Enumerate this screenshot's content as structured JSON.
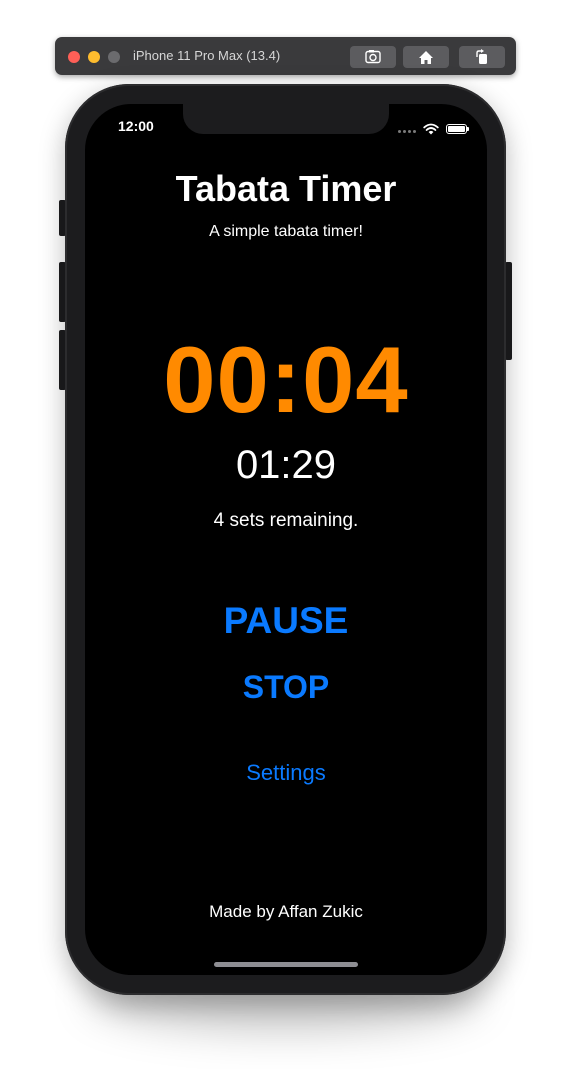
{
  "simulator": {
    "title": "iPhone 11 Pro Max (13.4)",
    "toolbar_icons": [
      "screenshot-icon",
      "home-icon",
      "rotate-icon"
    ]
  },
  "status_bar": {
    "time": "12:00"
  },
  "app": {
    "title": "Tabata Timer",
    "subtitle": "A simple tabata timer!",
    "interval_time": "00:04",
    "total_time": "01:29",
    "sets_remaining": "4 sets remaining.",
    "pause_label": "PAUSE",
    "stop_label": "STOP",
    "settings_label": "Settings",
    "credit": "Made by Affan Zukic"
  },
  "colors": {
    "accent_blue": "#0a7aff",
    "timer_orange": "#ff8a00",
    "screen_background": "#000000"
  }
}
